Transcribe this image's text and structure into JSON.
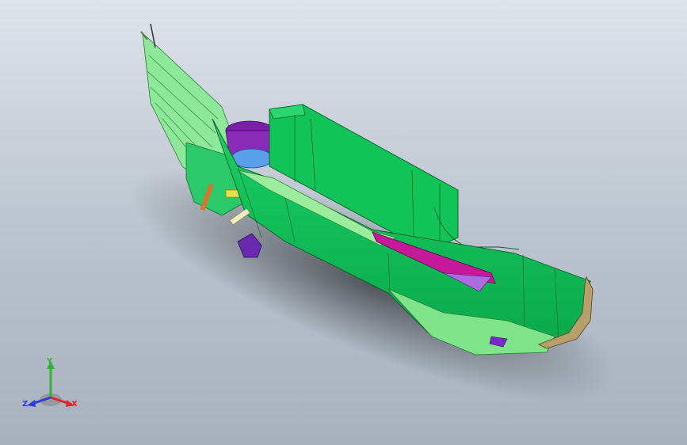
{
  "viewport": {
    "background_top": "#dfe3ea",
    "background_bottom": "#a8b1bd"
  },
  "model": {
    "colors": {
      "body_green": "#0ec35a",
      "light_green": "#7fe38a",
      "pale_green": "#b8f0b0",
      "purple": "#7a1fa8",
      "magenta": "#c41a9a",
      "blue": "#2a6fd6",
      "tan": "#b8a06a",
      "orange": "#d8762a",
      "yellow": "#e8e04a"
    }
  },
  "triad": {
    "x_label": "X",
    "y_label": "Y",
    "z_label": "Z",
    "x_color": "#e0282a",
    "y_color": "#2fb52f",
    "z_color": "#2a3fe0"
  }
}
